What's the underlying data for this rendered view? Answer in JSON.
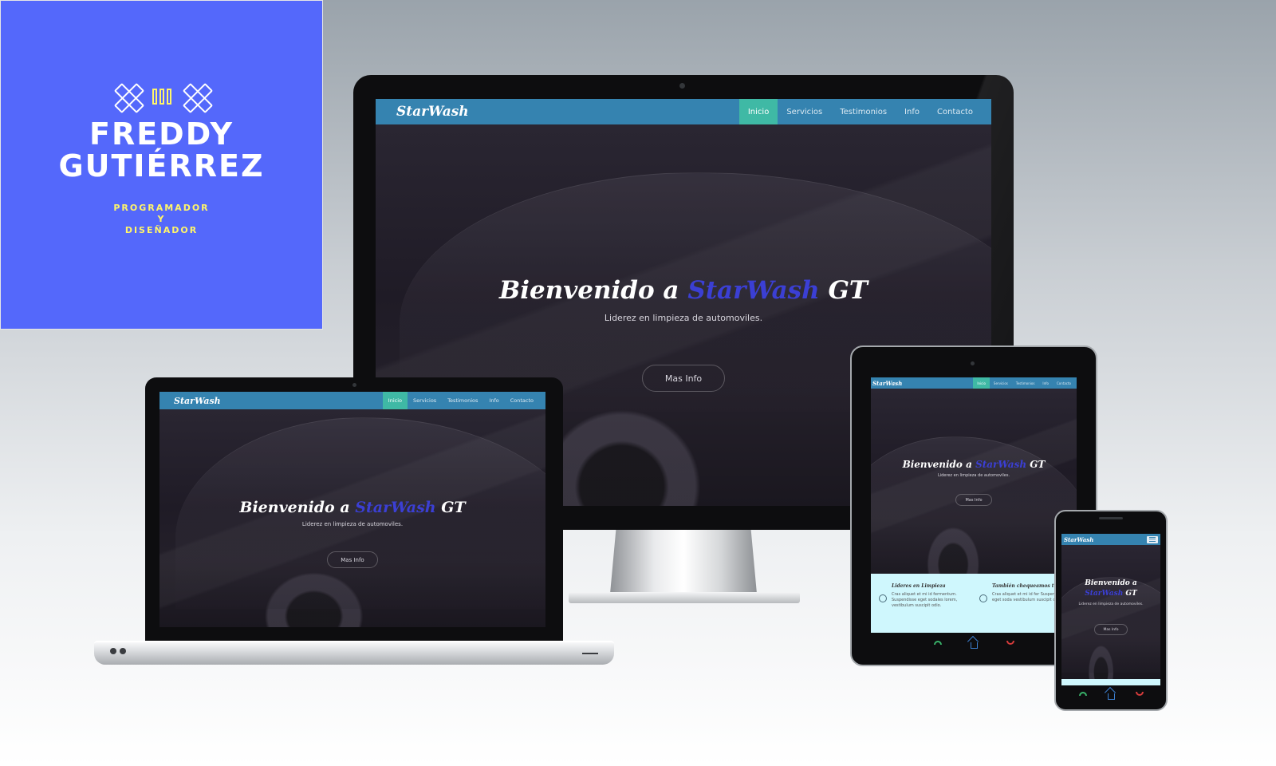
{
  "brand": {
    "name_line1": "FREDDY",
    "name_line2": "GUTIÉRREZ",
    "role_line1": "PROGRAMADOR",
    "role_line2": "Y",
    "role_line3": "DISEÑADOR",
    "background_color": "#5468fb",
    "accent_color": "#fff56a"
  },
  "site": {
    "logo": "StarWash",
    "nav": {
      "inicio": "Inicio",
      "servicios": "Servicios",
      "testimonios": "Testimonios",
      "info": "Info",
      "contacto": "Contacto"
    },
    "headline_prefix": "Bienvenido a",
    "headline_accent": "StarWash",
    "headline_suffix": "GT",
    "tagline": "Liderez en limpieza de automoviles.",
    "cta_label": "Mas Info",
    "nav_color": "#3583b0",
    "active_color": "#3fb9a5",
    "accent_color": "#3b3fd4"
  },
  "tablet_features": [
    {
      "title": "Lideres en Limpieza",
      "text": "Cras aliquet et mi id fermentum. Suspendisse eget sodales lorem, vestibulum suscipit odio."
    },
    {
      "title": "También chequeamos tu",
      "text": "Cras aliquet et mi id fer Suspendisse eget soda vestibulum suscipit odio."
    }
  ],
  "icons": {
    "call": "call-icon",
    "home": "home-icon",
    "end": "end-call-icon",
    "menu": "hamburger-icon"
  }
}
